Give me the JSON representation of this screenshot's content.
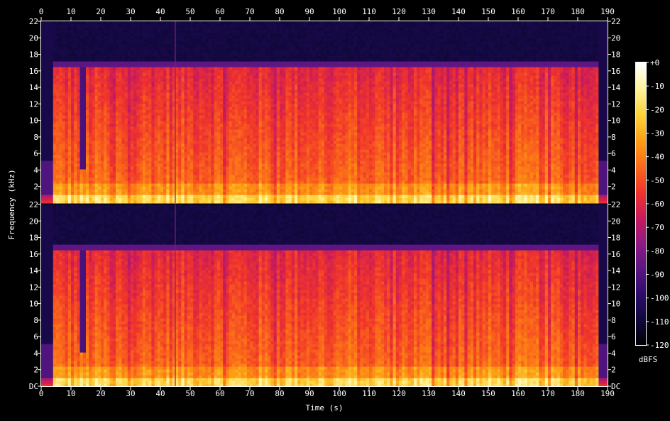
{
  "chart_data": {
    "type": "heatmap",
    "kind": "spectrogram",
    "channels": 2,
    "xlabel": "Time (s)",
    "ylabel": "Frequency (kHz)",
    "xlim": [
      0,
      190
    ],
    "x_ticks": [
      "0",
      "10",
      "20",
      "30",
      "40",
      "50",
      "60",
      "70",
      "80",
      "90",
      "100",
      "110",
      "120",
      "130",
      "140",
      "150",
      "160",
      "170",
      "180",
      "190"
    ],
    "ylim_khz": [
      0,
      22
    ],
    "y_ticks_top_panel": [
      "2",
      "4",
      "6",
      "8",
      "10",
      "12",
      "14",
      "16",
      "18",
      "20",
      "22"
    ],
    "y_ticks_bottom_panel": [
      "DC",
      "2",
      "4",
      "6",
      "8",
      "10",
      "12",
      "14",
      "16",
      "18",
      "20",
      "22"
    ],
    "colorbar": {
      "label": "dBFS",
      "range": [
        -120,
        0
      ],
      "ticks": [
        "+0",
        "-10",
        "-20",
        "-30",
        "-40",
        "-50",
        "-60",
        "-70",
        "-80",
        "-90",
        "-100",
        "-110",
        "-120"
      ],
      "colormap": [
        "#000000",
        "#10083a",
        "#2c0c6c",
        "#5a1684",
        "#8e1a84",
        "#c81a5c",
        "#f0342c",
        "#fb6a1a",
        "#fd9e14",
        "#fdd23a",
        "#fff29a",
        "#ffffff"
      ]
    },
    "approx_content": {
      "audio_start_s": 4,
      "audio_end_s": 187,
      "lowpass_cutoff_khz": 16.5,
      "quiet_dip_s": [
        13,
        15
      ],
      "transient_line_s": 45
    }
  }
}
